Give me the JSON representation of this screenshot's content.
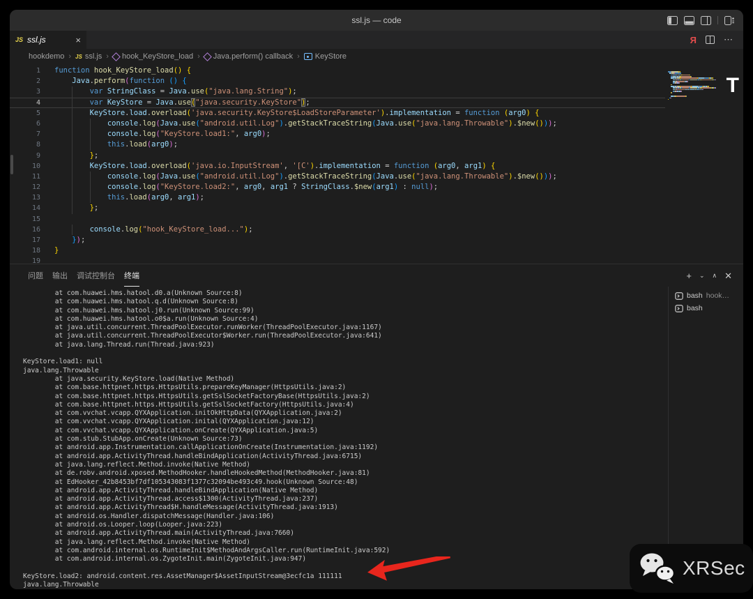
{
  "window": {
    "title": "ssl.js — code"
  },
  "titlebar_icons": [
    "layout-sidebar-left",
    "layout-panel",
    "layout-sidebar-right",
    "customize-layout"
  ],
  "tab": {
    "icon": "JS",
    "label": "ssl.js",
    "close_glyph": "×"
  },
  "editor_actions": {
    "run_glyph": "Я",
    "more_glyph": "⋯"
  },
  "breadcrumb": {
    "sep": "›",
    "items": [
      {
        "label": "hookdemo",
        "icon": ""
      },
      {
        "label": "ssl.js",
        "icon": "js"
      },
      {
        "label": "hook_KeyStore_load",
        "icon": "method"
      },
      {
        "label": "Java.perform() callback",
        "icon": "method"
      },
      {
        "label": "KeyStore",
        "icon": "variable"
      }
    ]
  },
  "code": {
    "current_line": 4,
    "lines": [
      {
        "n": 1,
        "ind": 0,
        "tok": [
          [
            "kw",
            "function"
          ],
          [
            "pl",
            " "
          ],
          [
            "fn",
            "hook_KeyStore_load"
          ],
          [
            "b1",
            "()"
          ],
          [
            "pl",
            " "
          ],
          [
            "b1",
            "{"
          ]
        ]
      },
      {
        "n": 2,
        "ind": 1,
        "tok": [
          [
            "vr",
            "Java"
          ],
          [
            "pl",
            "."
          ],
          [
            "fn",
            "perform"
          ],
          [
            "b2",
            "("
          ],
          [
            "kw",
            "function"
          ],
          [
            "pl",
            " "
          ],
          [
            "b3",
            "()"
          ],
          [
            "pl",
            " "
          ],
          [
            "b3",
            "{"
          ]
        ]
      },
      {
        "n": 3,
        "ind": 2,
        "tok": [
          [
            "kw",
            "var"
          ],
          [
            "pl",
            " "
          ],
          [
            "vr",
            "StringClass"
          ],
          [
            "pl",
            " = "
          ],
          [
            "vr",
            "Java"
          ],
          [
            "pl",
            "."
          ],
          [
            "fn",
            "use"
          ],
          [
            "b1",
            "("
          ],
          [
            "st",
            "\"java.lang.String\""
          ],
          [
            "b1",
            ")"
          ],
          [
            "pl",
            ";"
          ]
        ]
      },
      {
        "n": 4,
        "ind": 2,
        "tok": [
          [
            "kw",
            "var"
          ],
          [
            "pl",
            " "
          ],
          [
            "vr",
            "KeyStore"
          ],
          [
            "pl",
            " = "
          ],
          [
            "vr",
            "Java"
          ],
          [
            "pl",
            "."
          ],
          [
            "fn",
            "use"
          ],
          [
            "bm",
            "("
          ],
          [
            "st",
            "\"java.security.KeyStore\""
          ],
          [
            "bm",
            ")"
          ],
          [
            "pl",
            ";"
          ]
        ]
      },
      {
        "n": 5,
        "ind": 2,
        "tok": [
          [
            "vr",
            "KeyStore"
          ],
          [
            "pl",
            "."
          ],
          [
            "vr",
            "load"
          ],
          [
            "pl",
            "."
          ],
          [
            "fn",
            "overload"
          ],
          [
            "b1",
            "("
          ],
          [
            "st",
            "'java.security.KeyStore$LoadStoreParameter'"
          ],
          [
            "b1",
            ")"
          ],
          [
            "pl",
            "."
          ],
          [
            "vr",
            "implementation"
          ],
          [
            "pl",
            " = "
          ],
          [
            "kw",
            "function"
          ],
          [
            "pl",
            " "
          ],
          [
            "b1",
            "("
          ],
          [
            "vr",
            "arg0"
          ],
          [
            "b1",
            ")"
          ],
          [
            "pl",
            " "
          ],
          [
            "b1",
            "{"
          ]
        ]
      },
      {
        "n": 6,
        "ind": 3,
        "tok": [
          [
            "vr",
            "console"
          ],
          [
            "pl",
            "."
          ],
          [
            "fn",
            "log"
          ],
          [
            "b2",
            "("
          ],
          [
            "vr",
            "Java"
          ],
          [
            "pl",
            "."
          ],
          [
            "fn",
            "use"
          ],
          [
            "b3",
            "("
          ],
          [
            "st",
            "\"android.util.Log\""
          ],
          [
            "b3",
            ")"
          ],
          [
            "pl",
            "."
          ],
          [
            "fn",
            "getStackTraceString"
          ],
          [
            "b3",
            "("
          ],
          [
            "vr",
            "Java"
          ],
          [
            "pl",
            "."
          ],
          [
            "fn",
            "use"
          ],
          [
            "b1",
            "("
          ],
          [
            "st",
            "\"java.lang.Throwable\""
          ],
          [
            "b1",
            ")"
          ],
          [
            "pl",
            "."
          ],
          [
            "fn",
            "$new"
          ],
          [
            "b1",
            "()"
          ],
          [
            "b3",
            ")"
          ],
          [
            "b2",
            ")"
          ],
          [
            "pl",
            ";"
          ]
        ]
      },
      {
        "n": 7,
        "ind": 3,
        "tok": [
          [
            "vr",
            "console"
          ],
          [
            "pl",
            "."
          ],
          [
            "fn",
            "log"
          ],
          [
            "b2",
            "("
          ],
          [
            "st",
            "\"KeyStore.load1:\""
          ],
          [
            "pl",
            ", "
          ],
          [
            "vr",
            "arg0"
          ],
          [
            "b2",
            ")"
          ],
          [
            "pl",
            ";"
          ]
        ]
      },
      {
        "n": 8,
        "ind": 3,
        "tok": [
          [
            "kw",
            "this"
          ],
          [
            "pl",
            "."
          ],
          [
            "fn",
            "load"
          ],
          [
            "b2",
            "("
          ],
          [
            "vr",
            "arg0"
          ],
          [
            "b2",
            ")"
          ],
          [
            "pl",
            ";"
          ]
        ]
      },
      {
        "n": 9,
        "ind": 2,
        "tok": [
          [
            "b1",
            "}"
          ],
          [
            "pl",
            ";"
          ]
        ]
      },
      {
        "n": 10,
        "ind": 2,
        "tok": [
          [
            "vr",
            "KeyStore"
          ],
          [
            "pl",
            "."
          ],
          [
            "vr",
            "load"
          ],
          [
            "pl",
            "."
          ],
          [
            "fn",
            "overload"
          ],
          [
            "b1",
            "("
          ],
          [
            "st",
            "'java.io.InputStream'"
          ],
          [
            "pl",
            ", "
          ],
          [
            "st",
            "'[C'"
          ],
          [
            "b1",
            ")"
          ],
          [
            "pl",
            "."
          ],
          [
            "vr",
            "implementation"
          ],
          [
            "pl",
            " = "
          ],
          [
            "kw",
            "function"
          ],
          [
            "pl",
            " "
          ],
          [
            "b1",
            "("
          ],
          [
            "vr",
            "arg0"
          ],
          [
            "pl",
            ", "
          ],
          [
            "vr",
            "arg1"
          ],
          [
            "b1",
            ")"
          ],
          [
            "pl",
            " "
          ],
          [
            "b1",
            "{"
          ]
        ]
      },
      {
        "n": 11,
        "ind": 3,
        "tok": [
          [
            "vr",
            "console"
          ],
          [
            "pl",
            "."
          ],
          [
            "fn",
            "log"
          ],
          [
            "b2",
            "("
          ],
          [
            "vr",
            "Java"
          ],
          [
            "pl",
            "."
          ],
          [
            "fn",
            "use"
          ],
          [
            "b3",
            "("
          ],
          [
            "st",
            "\"android.util.Log\""
          ],
          [
            "b3",
            ")"
          ],
          [
            "pl",
            "."
          ],
          [
            "fn",
            "getStackTraceString"
          ],
          [
            "b3",
            "("
          ],
          [
            "vr",
            "Java"
          ],
          [
            "pl",
            "."
          ],
          [
            "fn",
            "use"
          ],
          [
            "b1",
            "("
          ],
          [
            "st",
            "\"java.lang.Throwable\""
          ],
          [
            "b1",
            ")"
          ],
          [
            "pl",
            "."
          ],
          [
            "fn",
            "$new"
          ],
          [
            "b1",
            "()"
          ],
          [
            "b3",
            ")"
          ],
          [
            "b2",
            ")"
          ],
          [
            "pl",
            ";"
          ]
        ]
      },
      {
        "n": 12,
        "ind": 3,
        "tok": [
          [
            "vr",
            "console"
          ],
          [
            "pl",
            "."
          ],
          [
            "fn",
            "log"
          ],
          [
            "b2",
            "("
          ],
          [
            "st",
            "\"KeyStore.load2:\""
          ],
          [
            "pl",
            ", "
          ],
          [
            "vr",
            "arg0"
          ],
          [
            "pl",
            ", "
          ],
          [
            "vr",
            "arg1"
          ],
          [
            "pl",
            " ? "
          ],
          [
            "vr",
            "StringClass"
          ],
          [
            "pl",
            "."
          ],
          [
            "fn",
            "$new"
          ],
          [
            "b3",
            "("
          ],
          [
            "vr",
            "arg1"
          ],
          [
            "b3",
            ")"
          ],
          [
            "pl",
            " : "
          ],
          [
            "kw",
            "null"
          ],
          [
            "b2",
            ")"
          ],
          [
            "pl",
            ";"
          ]
        ]
      },
      {
        "n": 13,
        "ind": 3,
        "tok": [
          [
            "kw",
            "this"
          ],
          [
            "pl",
            "."
          ],
          [
            "fn",
            "load"
          ],
          [
            "b2",
            "("
          ],
          [
            "vr",
            "arg0"
          ],
          [
            "pl",
            ", "
          ],
          [
            "vr",
            "arg1"
          ],
          [
            "b2",
            ")"
          ],
          [
            "pl",
            ";"
          ]
        ]
      },
      {
        "n": 14,
        "ind": 2,
        "tok": [
          [
            "b1",
            "}"
          ],
          [
            "pl",
            ";"
          ]
        ]
      },
      {
        "n": 15,
        "ind": 0,
        "tok": []
      },
      {
        "n": 16,
        "ind": 2,
        "tok": [
          [
            "vr",
            "console"
          ],
          [
            "pl",
            "."
          ],
          [
            "fn",
            "log"
          ],
          [
            "b1",
            "("
          ],
          [
            "st",
            "\"hook_KeyStore_load...\""
          ],
          [
            "b1",
            ")"
          ],
          [
            "pl",
            ";"
          ]
        ]
      },
      {
        "n": 17,
        "ind": 1,
        "tok": [
          [
            "b3",
            "}"
          ],
          [
            "b2",
            ")"
          ],
          [
            "pl",
            ";"
          ]
        ]
      },
      {
        "n": 18,
        "ind": 0,
        "tok": [
          [
            "b1",
            "}"
          ]
        ]
      },
      {
        "n": 19,
        "ind": 0,
        "tok": []
      }
    ]
  },
  "panel": {
    "tabs": [
      "问题",
      "输出",
      "调试控制台",
      "终端"
    ],
    "active_tab": "终端",
    "actions": {
      "plus": "+",
      "chevron_down": "⌄",
      "chevron_up": "∧",
      "close": "✕"
    }
  },
  "terminal": {
    "lines": [
      "        at com.huawei.hms.hatool.d0.a(Unknown Source:8)",
      "        at com.huawei.hms.hatool.q.d(Unknown Source:8)",
      "        at com.huawei.hms.hatool.j0.run(Unknown Source:99)",
      "        at com.huawei.hms.hatool.o0$a.run(Unknown Source:4)",
      "        at java.util.concurrent.ThreadPoolExecutor.runWorker(ThreadPoolExecutor.java:1167)",
      "        at java.util.concurrent.ThreadPoolExecutor$Worker.run(ThreadPoolExecutor.java:641)",
      "        at java.lang.Thread.run(Thread.java:923)",
      "",
      "KeyStore.load1: null",
      "java.lang.Throwable",
      "        at java.security.KeyStore.load(Native Method)",
      "        at com.base.httpnet.https.HttpsUtils.prepareKeyManager(HttpsUtils.java:2)",
      "        at com.base.httpnet.https.HttpsUtils.getSslSocketFactoryBase(HttpsUtils.java:2)",
      "        at com.base.httpnet.https.HttpsUtils.getSslSocketFactory(HttpsUtils.java:4)",
      "        at com.vvchat.vcapp.QYXApplication.initOkHttpData(QYXApplication.java:2)",
      "        at com.vvchat.vcapp.QYXApplication.inital(QYXApplication.java:12)",
      "        at com.vvchat.vcapp.QYXApplication.onCreate(QYXApplication.java:5)",
      "        at com.stub.StubApp.onCreate(Unknown Source:73)",
      "        at android.app.Instrumentation.callApplicationOnCreate(Instrumentation.java:1192)",
      "        at android.app.ActivityThread.handleBindApplication(ActivityThread.java:6715)",
      "        at java.lang.reflect.Method.invoke(Native Method)",
      "        at de.robv.android.xposed.MethodHooker.handleHookedMethod(MethodHooker.java:81)",
      "        at EdHooker_42b8453bf7df105343083f1377c32094be493c49.hook(Unknown Source:48)",
      "        at android.app.ActivityThread.handleBindApplication(Native Method)",
      "        at android.app.ActivityThread.access$1300(ActivityThread.java:237)",
      "        at android.app.ActivityThread$H.handleMessage(ActivityThread.java:1913)",
      "        at android.os.Handler.dispatchMessage(Handler.java:106)",
      "        at android.os.Looper.loop(Looper.java:223)",
      "        at android.app.ActivityThread.main(ActivityThread.java:7660)",
      "        at java.lang.reflect.Method.invoke(Native Method)",
      "        at com.android.internal.os.RuntimeInit$MethodAndArgsCaller.run(RuntimeInit.java:592)",
      "        at com.android.internal.os.ZygoteInit.main(ZygoteInit.java:947)",
      "",
      "KeyStore.load2: android.content.res.AssetManager$AssetInputStream@3ecfc1a 111111",
      "java.lang.Throwable"
    ]
  },
  "terminal_list": [
    {
      "name": "bash",
      "suffix": "hook…"
    },
    {
      "name": "bash",
      "suffix": ""
    }
  ],
  "watermark": {
    "text": "XRSec",
    "letter_overlay": "T"
  },
  "colors": {
    "accent_red": "#e8261d",
    "keyword": "#569cd6",
    "function": "#dcdcaa",
    "variable": "#9cdcfe",
    "string": "#ce9178",
    "bracket1": "#ffd700",
    "bracket2": "#da70d6",
    "bracket3": "#179fff",
    "editor_bg": "#1e1e1e",
    "titlebar_bg": "#2c2c2c",
    "tabstrip_bg": "#252526"
  }
}
